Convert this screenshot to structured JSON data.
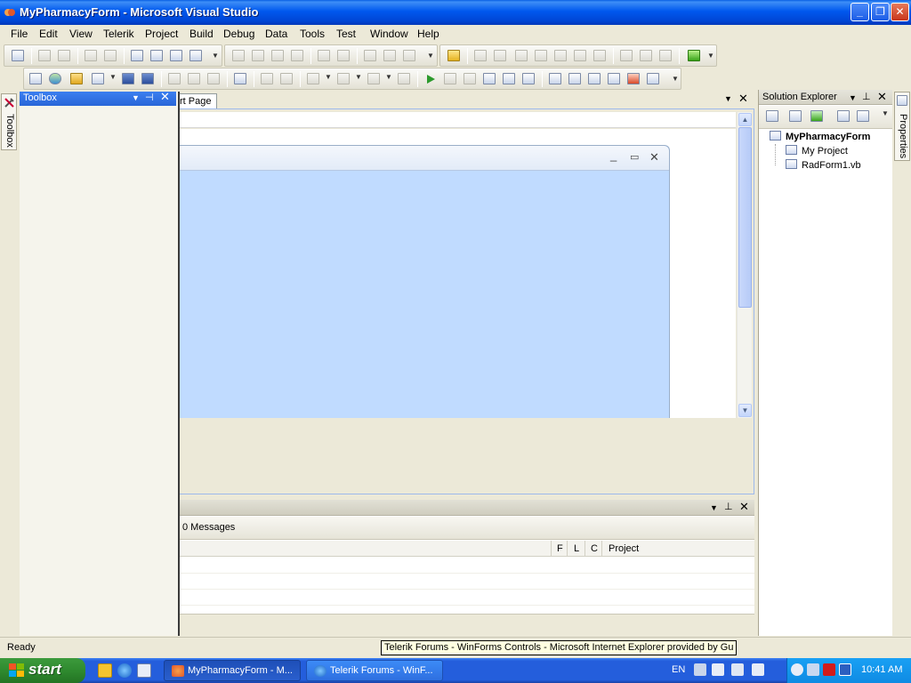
{
  "window": {
    "title": "MyPharmacyForm - Microsoft Visual Studio",
    "minimize_glyph": "_",
    "maximize_glyph": "❐",
    "close_glyph": "✕"
  },
  "menu": [
    "File",
    "Edit",
    "View",
    "Telerik",
    "Project",
    "Build",
    "Debug",
    "Data",
    "Tools",
    "Test",
    "Window",
    "Help"
  ],
  "toolbox": {
    "tab_label": "Toolbox",
    "title": "Toolbox"
  },
  "document": {
    "active_tab": "rt Page"
  },
  "errors_panel": {
    "messages_label": "0 Messages",
    "columns": {
      "file": "F",
      "line": "L",
      "column": "C",
      "project": "Project"
    }
  },
  "solution_explorer": {
    "title": "Solution Explorer",
    "root": "MyPharmacyForm",
    "items": [
      "My Project",
      "RadForm1.vb"
    ]
  },
  "properties_tab_label": "Properties",
  "statusbar": {
    "text": "Ready",
    "tooltip": "Telerik Forums - WinForms Controls - Microsoft Internet Explorer provided by Gu"
  },
  "taskbar": {
    "start_label": "start",
    "tasks": [
      "MyPharmacyForm - M...",
      "Telerik Forums - WinF..."
    ],
    "language": "EN",
    "clock": "10:41 AM"
  },
  "colors": {
    "titlebar": "#0058ee",
    "designer_form": "#c0dbff",
    "taskbar": "#245edc",
    "start_button": "#2f8a2f"
  }
}
